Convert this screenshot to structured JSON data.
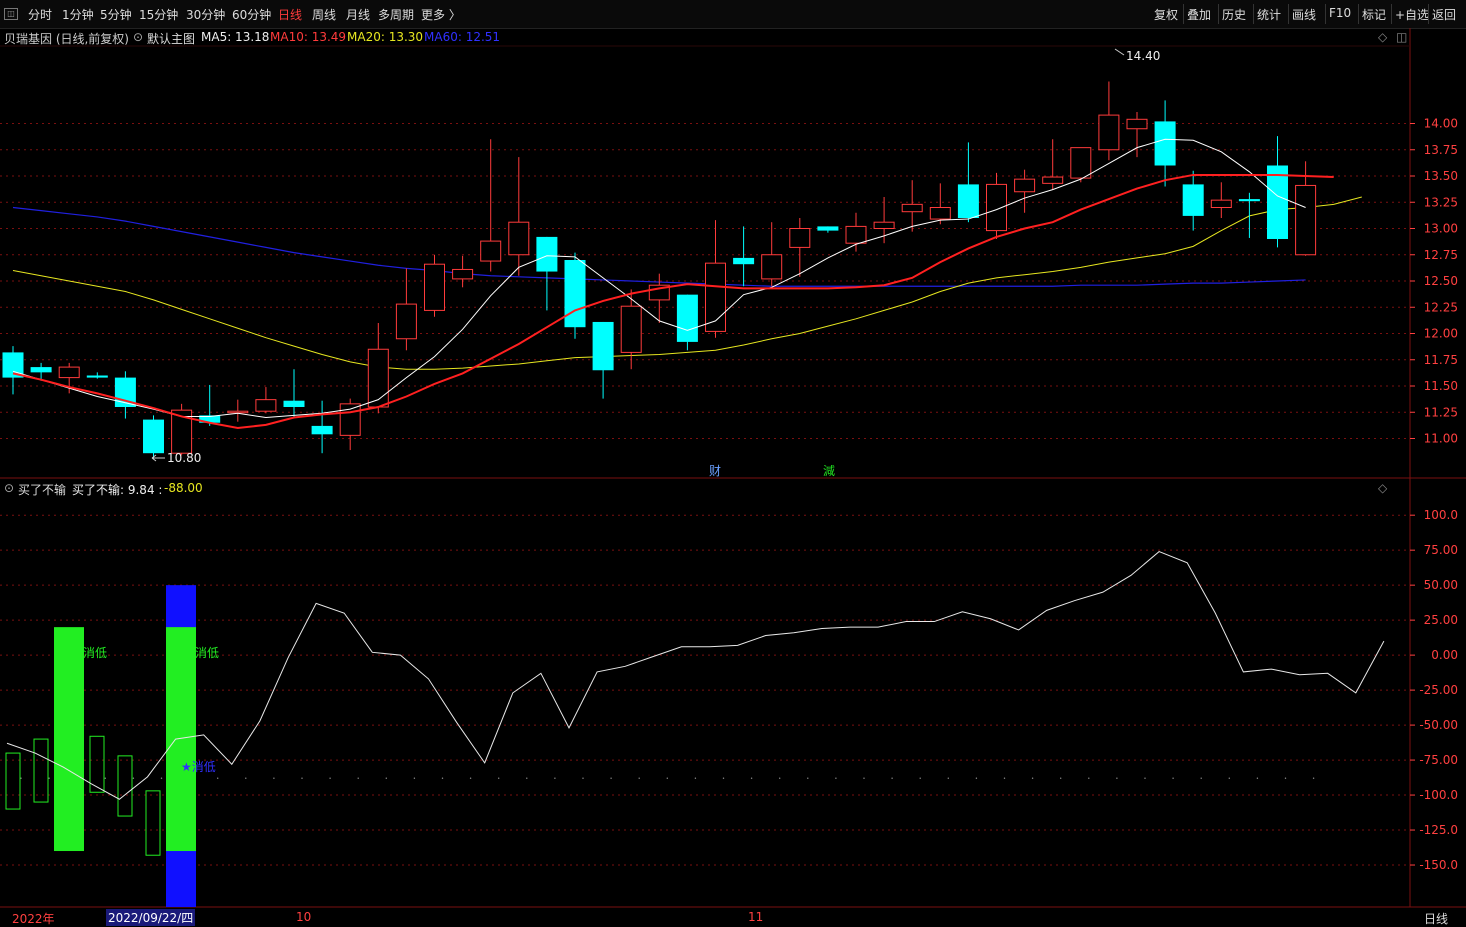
{
  "toolbar": {
    "periods": [
      "分时",
      "1分钟",
      "5分钟",
      "15分钟",
      "30分钟",
      "60分钟",
      "日线",
      "周线",
      "月线",
      "多周期",
      "更多 〉"
    ],
    "active": "日线",
    "right": [
      "复权",
      "叠加",
      "历史",
      "统计",
      "画线",
      "F10",
      "标记",
      "+自选",
      "返回"
    ]
  },
  "main_header": {
    "stock": "贝瑞基因 (日线,前复权)",
    "template": "默认主图",
    "ma5": "MA5: 13.18",
    "ma10": "MA10: 13.49",
    "ma20": "MA20: 13.30",
    "ma60": "MA60: 12.51"
  },
  "sub_header": {
    "name": "买了不输",
    "value_label": "买了不输: 9.84 : ",
    "value_neg": "-88.00"
  },
  "annotations": {
    "high": "14.40",
    "low": "10.80",
    "cai": "财",
    "jian": "減",
    "xiao_di_1": "消低",
    "xiao_di_2": "消低",
    "star_label": "★消低"
  },
  "bottom": {
    "year": "2022年",
    "date": "2022/09/22/四",
    "month10": "10",
    "month11": "11",
    "period": "日线"
  },
  "colors": {
    "up": "#ff3b3b",
    "down": "#00ffff",
    "ma5": "#ffffff",
    "ma10": "#ff2020",
    "ma20": "#e6e620",
    "ma60": "#2020e0",
    "grid": "#7a1010",
    "axis_text": "#ff4040"
  },
  "chart_data": [
    {
      "type": "candlestick",
      "title": "贝瑞基因 (日线,前复权)",
      "ylim": [
        10.7,
        14.7
      ],
      "yticks": [
        11.0,
        11.25,
        11.5,
        11.75,
        12.0,
        12.25,
        12.5,
        12.75,
        13.0,
        13.25,
        13.5,
        13.75,
        14.0
      ],
      "candles": [
        {
          "o": 11.82,
          "h": 11.88,
          "l": 11.42,
          "c": 11.58
        },
        {
          "o": 11.68,
          "h": 11.72,
          "l": 11.55,
          "c": 11.63
        },
        {
          "o": 11.58,
          "h": 11.72,
          "l": 11.43,
          "c": 11.68
        },
        {
          "o": 11.6,
          "h": 11.63,
          "l": 11.57,
          "c": 11.58
        },
        {
          "o": 11.58,
          "h": 11.64,
          "l": 11.19,
          "c": 11.3
        },
        {
          "o": 11.18,
          "h": 11.22,
          "l": 10.8,
          "c": 10.86
        },
        {
          "o": 10.86,
          "h": 11.33,
          "l": 10.84,
          "c": 11.27
        },
        {
          "o": 11.22,
          "h": 11.51,
          "l": 11.12,
          "c": 11.15
        },
        {
          "o": 11.25,
          "h": 11.37,
          "l": 11.16,
          "c": 11.26
        },
        {
          "o": 11.26,
          "h": 11.49,
          "l": 11.24,
          "c": 11.37
        },
        {
          "o": 11.36,
          "h": 11.66,
          "l": 11.21,
          "c": 11.3
        },
        {
          "o": 11.12,
          "h": 11.36,
          "l": 10.86,
          "c": 11.04
        },
        {
          "o": 11.03,
          "h": 11.38,
          "l": 10.89,
          "c": 11.33
        },
        {
          "o": 11.3,
          "h": 12.1,
          "l": 11.24,
          "c": 11.85
        },
        {
          "o": 11.95,
          "h": 12.62,
          "l": 11.84,
          "c": 12.28
        },
        {
          "o": 12.22,
          "h": 12.75,
          "l": 12.16,
          "c": 12.66
        },
        {
          "o": 12.52,
          "h": 12.74,
          "l": 12.44,
          "c": 12.61
        },
        {
          "o": 12.69,
          "h": 13.85,
          "l": 12.59,
          "c": 12.88
        },
        {
          "o": 12.75,
          "h": 13.68,
          "l": 12.55,
          "c": 13.06
        },
        {
          "o": 12.92,
          "h": 12.92,
          "l": 12.22,
          "c": 12.59
        },
        {
          "o": 12.7,
          "h": 12.77,
          "l": 11.95,
          "c": 12.06
        },
        {
          "o": 12.11,
          "h": 12.11,
          "l": 11.38,
          "c": 11.65
        },
        {
          "o": 11.82,
          "h": 12.42,
          "l": 11.66,
          "c": 12.26
        },
        {
          "o": 12.32,
          "h": 12.57,
          "l": 12.1,
          "c": 12.46
        },
        {
          "o": 12.37,
          "h": 12.37,
          "l": 11.84,
          "c": 11.92
        },
        {
          "o": 12.02,
          "h": 13.08,
          "l": 11.96,
          "c": 12.67
        },
        {
          "o": 12.72,
          "h": 13.02,
          "l": 12.45,
          "c": 12.66
        },
        {
          "o": 12.52,
          "h": 13.06,
          "l": 12.45,
          "c": 12.75
        },
        {
          "o": 12.82,
          "h": 13.1,
          "l": 12.54,
          "c": 13.0
        },
        {
          "o": 13.02,
          "h": 13.02,
          "l": 12.96,
          "c": 12.98
        },
        {
          "o": 12.86,
          "h": 13.15,
          "l": 12.78,
          "c": 13.02
        },
        {
          "o": 13.0,
          "h": 13.3,
          "l": 12.86,
          "c": 13.06
        },
        {
          "o": 13.16,
          "h": 13.46,
          "l": 12.97,
          "c": 13.23
        },
        {
          "o": 13.09,
          "h": 13.43,
          "l": 13.04,
          "c": 13.2
        },
        {
          "o": 13.42,
          "h": 13.82,
          "l": 13.06,
          "c": 13.1
        },
        {
          "o": 12.98,
          "h": 13.53,
          "l": 12.9,
          "c": 13.42
        },
        {
          "o": 13.35,
          "h": 13.56,
          "l": 13.15,
          "c": 13.47
        },
        {
          "o": 13.43,
          "h": 13.85,
          "l": 13.37,
          "c": 13.49
        },
        {
          "o": 13.48,
          "h": 13.77,
          "l": 13.44,
          "c": 13.77
        },
        {
          "o": 13.75,
          "h": 14.4,
          "l": 13.65,
          "c": 14.08
        },
        {
          "o": 13.95,
          "h": 14.11,
          "l": 13.68,
          "c": 14.04
        },
        {
          "o": 14.02,
          "h": 14.22,
          "l": 13.4,
          "c": 13.6
        },
        {
          "o": 13.42,
          "h": 13.55,
          "l": 12.98,
          "c": 13.12
        },
        {
          "o": 13.2,
          "h": 13.44,
          "l": 13.1,
          "c": 13.27
        },
        {
          "o": 13.28,
          "h": 13.34,
          "l": 12.91,
          "c": 13.26
        },
        {
          "o": 13.6,
          "h": 13.88,
          "l": 12.82,
          "c": 12.9
        },
        {
          "o": 12.75,
          "h": 13.64,
          "l": 12.74,
          "c": 13.41
        }
      ],
      "ma5": [
        11.64,
        11.56,
        11.48,
        11.4,
        11.34,
        11.28,
        11.21,
        11.21,
        11.24,
        11.2,
        11.22,
        11.24,
        11.28,
        11.37,
        11.58,
        11.78,
        12.04,
        12.36,
        12.63,
        12.74,
        12.73,
        12.53,
        12.33,
        12.12,
        12.03,
        12.12,
        12.37,
        12.44,
        12.57,
        12.72,
        12.85,
        12.93,
        13.02,
        13.08,
        13.09,
        13.18,
        13.29,
        13.37,
        13.47,
        13.62,
        13.77,
        13.85,
        13.84,
        13.73,
        13.54,
        13.31,
        13.2
      ],
      "ma10": [
        11.62,
        11.56,
        11.49,
        11.43,
        11.36,
        11.29,
        11.21,
        11.15,
        11.1,
        11.13,
        11.2,
        11.23,
        11.25,
        11.3,
        11.4,
        11.52,
        11.62,
        11.76,
        11.9,
        12.06,
        12.22,
        12.31,
        12.38,
        12.43,
        12.47,
        12.45,
        12.43,
        12.43,
        12.43,
        12.43,
        12.44,
        12.46,
        12.53,
        12.68,
        12.81,
        12.92,
        13.0,
        13.06,
        13.18,
        13.28,
        13.38,
        13.46,
        13.51,
        13.51,
        13.51,
        13.51,
        13.5,
        13.49
      ],
      "ma20": [
        12.6,
        12.55,
        12.5,
        12.45,
        12.4,
        12.32,
        12.23,
        12.14,
        12.05,
        11.96,
        11.88,
        11.8,
        11.73,
        11.68,
        11.66,
        11.66,
        11.67,
        11.69,
        11.71,
        11.74,
        11.77,
        11.78,
        11.79,
        11.8,
        11.82,
        11.84,
        11.89,
        11.95,
        12.0,
        12.07,
        12.14,
        12.22,
        12.3,
        12.4,
        12.48,
        12.53,
        12.56,
        12.59,
        12.63,
        12.68,
        12.72,
        12.76,
        12.83,
        12.98,
        13.12,
        13.18,
        13.2,
        13.23,
        13.3
      ],
      "ma60": [
        13.2,
        13.17,
        13.14,
        13.11,
        13.07,
        13.02,
        12.97,
        12.92,
        12.87,
        12.82,
        12.77,
        12.73,
        12.69,
        12.65,
        12.62,
        12.6,
        12.57,
        12.55,
        12.54,
        12.53,
        12.52,
        12.51,
        12.5,
        12.49,
        12.48,
        12.47,
        12.46,
        12.45,
        12.45,
        12.45,
        12.45,
        12.45,
        12.45,
        12.45,
        12.45,
        12.45,
        12.45,
        12.45,
        12.46,
        12.46,
        12.46,
        12.47,
        12.48,
        12.48,
        12.49,
        12.5,
        12.51
      ]
    },
    {
      "type": "line",
      "title": "买了不输",
      "ylim": [
        -175,
        118
      ],
      "yticks": [
        100.0,
        75.0,
        50.0,
        25.0,
        0.0,
        -25.0,
        -50.0,
        -75.0,
        -100.0,
        -125.0,
        -150.0
      ],
      "line": [
        -88,
        -94,
        -85,
        -80,
        -84,
        -90,
        -99,
        -110,
        -105,
        -84,
        -86,
        -90,
        -101,
        -67,
        -88,
        -86,
        -100,
        -50,
        -53,
        -65,
        -60,
        -54,
        -52,
        -58,
        -48,
        -56,
        -62,
        -53,
        -40,
        -35,
        -30,
        -28,
        -25,
        -27,
        -20,
        -25,
        -35,
        -22,
        -17,
        -11,
        -5,
        8,
        3,
        -10,
        -18,
        -12,
        -28,
        -25,
        -30,
        -10,
        -14,
        -18,
        -30,
        -48,
        -38,
        -45,
        -60,
        -55,
        -65,
        -60,
        -68,
        -60,
        -48
      ],
      "white_line": [
        -63,
        -70,
        -80,
        -92,
        -103,
        -87,
        -60,
        -57,
        -78,
        -47,
        -2,
        37,
        30,
        2,
        0,
        -17,
        -48,
        -77,
        -27,
        -13,
        -52,
        -12,
        -8,
        -1,
        6,
        6,
        7,
        14,
        16,
        19,
        20,
        20,
        24,
        24,
        31,
        26,
        18,
        32,
        39,
        45,
        57,
        74,
        66,
        30,
        -12,
        -10,
        -14,
        -13,
        -27,
        10
      ],
      "boxes": [
        {
          "top": -70,
          "bottom": -110,
          "filled": false
        },
        {
          "top": -60,
          "bottom": -105,
          "filled": false
        },
        {
          "top": 20,
          "bottom": -140,
          "filled": true,
          "label": "消低"
        },
        {
          "top": -58,
          "bottom": -98,
          "filled": false
        },
        {
          "top": -72,
          "bottom": -115,
          "filled": false
        },
        {
          "top": -97,
          "bottom": -143,
          "filled": false
        },
        {
          "top": 20,
          "bottom": -140,
          "filled": true,
          "label": "消低",
          "blue_top": 50,
          "blue_bottom": -180
        }
      ],
      "dotted_level": -88
    }
  ]
}
